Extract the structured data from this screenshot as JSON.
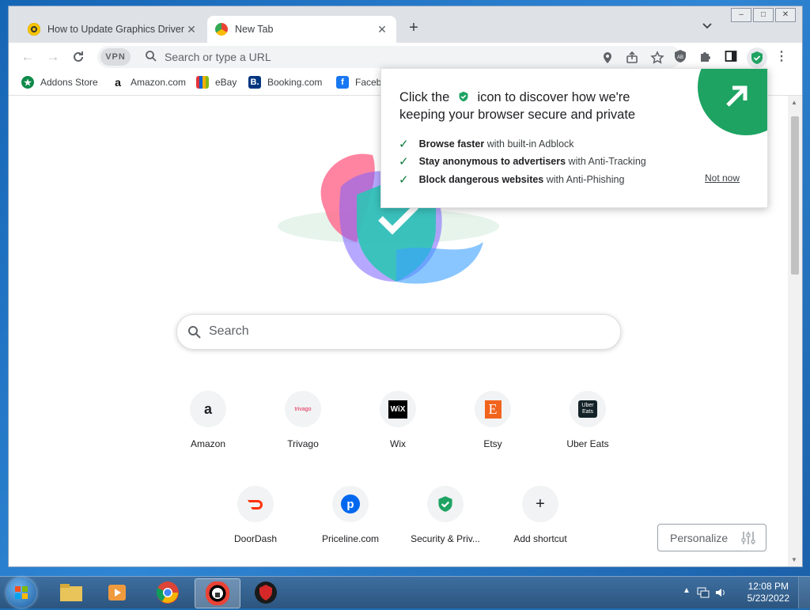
{
  "tabs": [
    {
      "title": "How to Update Graphics Driver f",
      "close": "✕"
    },
    {
      "title": "New Tab",
      "close": "✕"
    }
  ],
  "toolbar": {
    "vpn_label": "VPN",
    "omnibox_placeholder": "Search or type a URL"
  },
  "bookmarks": [
    {
      "label": "Addons Store"
    },
    {
      "label": "Amazon.com"
    },
    {
      "label": "eBay"
    },
    {
      "label": "Booking.com"
    },
    {
      "label": "Faceb"
    }
  ],
  "popup": {
    "headline_part1": "Click the",
    "headline_part2": "icon to discover how we're keeping your browser secure and private",
    "features": [
      {
        "bold": "Browse faster",
        "rest": " with built-in Adblock"
      },
      {
        "bold": "Stay anonymous to advertisers",
        "rest": " with Anti-Tracking"
      },
      {
        "bold": "Block dangerous websites",
        "rest": " with Anti-Phishing"
      }
    ],
    "not_now": "Not now"
  },
  "search": {
    "placeholder": "Search"
  },
  "shortcuts": [
    {
      "label": "Amazon",
      "icon": "a"
    },
    {
      "label": "Trivago",
      "icon": "trivago"
    },
    {
      "label": "Wix",
      "icon": "WiX"
    },
    {
      "label": "Etsy",
      "icon": "E"
    },
    {
      "label": "Uber Eats",
      "icon": "Uber Eats"
    },
    {
      "label": "DoorDash",
      "icon": "doordash-icon"
    },
    {
      "label": "Priceline.com",
      "icon": "p"
    },
    {
      "label": "Security & Priv...",
      "icon": "shield-check-icon"
    },
    {
      "label": "Add shortcut",
      "icon": "+"
    }
  ],
  "personalize": {
    "label": "Personalize"
  },
  "taskbar": {
    "time": "12:08 PM",
    "date": "5/23/2022"
  },
  "colors": {
    "accent_green": "#1ea362",
    "chrome_gray": "#dee1e6",
    "taskbar_blue": "#2c557f"
  }
}
